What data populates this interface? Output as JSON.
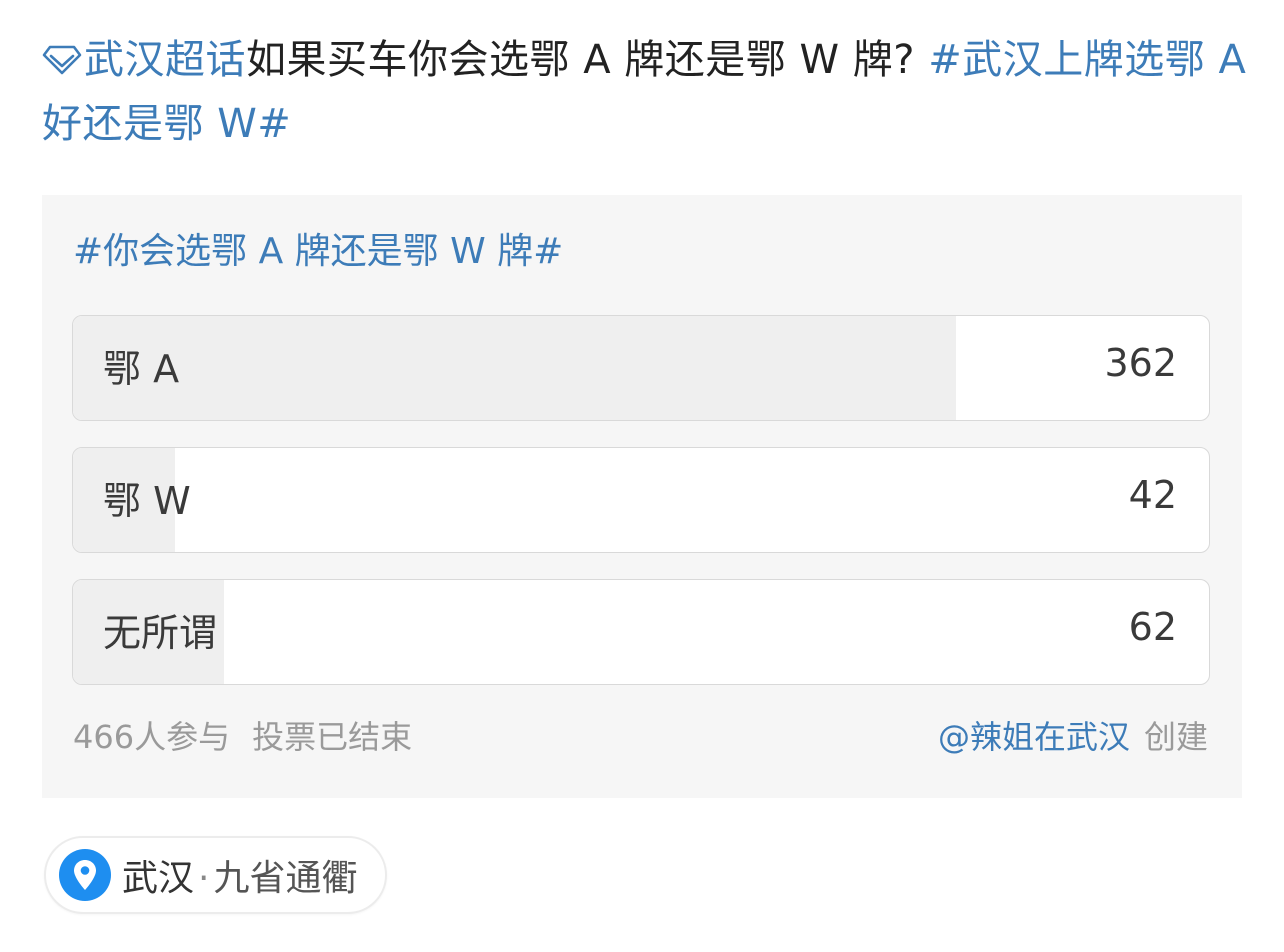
{
  "post": {
    "topic_icon": "diamond-icon",
    "supertopic": "武汉超话",
    "text": "如果买车你会选鄂 A 牌还是鄂 W 牌?",
    "hashtag": "#武汉上牌选鄂 A 好还是鄂 W#"
  },
  "poll": {
    "title": "#你会选鄂 A 牌还是鄂 W 牌#",
    "options": [
      {
        "label": "鄂 A",
        "count": "362",
        "share": 0.777
      },
      {
        "label": "鄂 W",
        "count": "42",
        "share": 0.09
      },
      {
        "label": "无所谓",
        "count": "62",
        "share": 0.133
      }
    ],
    "participants": "466人参与",
    "status": "投票已结束",
    "creator": "@辣姐在武汉",
    "created_label": "创建"
  },
  "location": {
    "icon": "location-pin-icon",
    "city": "武汉",
    "separator": "·",
    "name": "九省通衢"
  },
  "colors": {
    "link": "#3d7cb8",
    "card_bg": "#f6f6f6",
    "bar_fill": "#efefef",
    "pin": "#1e8ef0"
  }
}
